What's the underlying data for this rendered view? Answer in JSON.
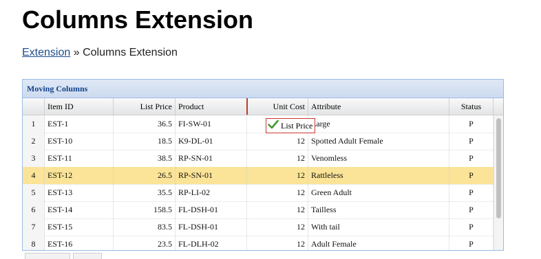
{
  "page": {
    "title": "Columns Extension",
    "breadcrumb": {
      "link": "Extension",
      "separator": "»",
      "current": "Columns Extension"
    }
  },
  "grid": {
    "title": "Moving Columns",
    "columns": [
      "",
      "Item ID",
      "List Price",
      "Product",
      "Unit Cost",
      "Attribute",
      "Status"
    ],
    "rows": [
      {
        "num": "1",
        "id": "EST-1",
        "list_price": "36.5",
        "product": "FI-SW-01",
        "unit_cost": "",
        "attribute": "Large",
        "status": "P"
      },
      {
        "num": "2",
        "id": "EST-10",
        "list_price": "18.5",
        "product": "K9-DL-01",
        "unit_cost": "12",
        "attribute": "Spotted Adult Female",
        "status": "P"
      },
      {
        "num": "3",
        "id": "EST-11",
        "list_price": "38.5",
        "product": "RP-SN-01",
        "unit_cost": "12",
        "attribute": "Venomless",
        "status": "P"
      },
      {
        "num": "4",
        "id": "EST-12",
        "list_price": "26.5",
        "product": "RP-SN-01",
        "unit_cost": "12",
        "attribute": "Rattleless",
        "status": "P",
        "selected": true
      },
      {
        "num": "5",
        "id": "EST-13",
        "list_price": "35.5",
        "product": "RP-LI-02",
        "unit_cost": "12",
        "attribute": "Green Adult",
        "status": "P"
      },
      {
        "num": "6",
        "id": "EST-14",
        "list_price": "158.5",
        "product": "FL-DSH-01",
        "unit_cost": "12",
        "attribute": "Tailless",
        "status": "P"
      },
      {
        "num": "7",
        "id": "EST-15",
        "list_price": "83.5",
        "product": "FL-DSH-01",
        "unit_cost": "12",
        "attribute": "With tail",
        "status": "P"
      },
      {
        "num": "8",
        "id": "EST-16",
        "list_price": "23.5",
        "product": "FL-DLH-02",
        "unit_cost": "12",
        "attribute": "Adult Female",
        "status": "P"
      }
    ],
    "drag_proxy": {
      "label": "List Price",
      "icon": "check-icon"
    },
    "colors": {
      "selected_row": "#fbe397",
      "header_blue": "#15428b",
      "drop_marker": "#c0392b"
    }
  }
}
